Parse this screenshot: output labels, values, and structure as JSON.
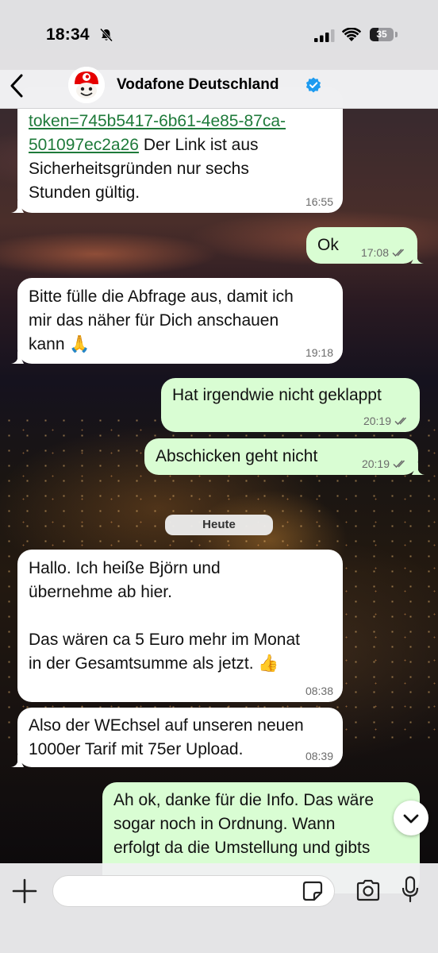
{
  "status_bar": {
    "time": "18:34",
    "battery": "35"
  },
  "header": {
    "contact_name": "Vodafone Deutschland"
  },
  "messages": [
    {
      "direction": "in",
      "link": "token=745b5417-6b61-4e85-87ca-\n501097ec2a26",
      "text": " Der Link ist aus\nSicherheitsgründen nur sechs\nStunden gültig.",
      "time": "16:55"
    },
    {
      "direction": "out",
      "text": "Ok",
      "time": "17:08"
    },
    {
      "direction": "in",
      "text": "Bitte fülle die Abfrage aus, damit ich\nmir das näher für Dich anschauen\nkann 🙏",
      "time": "19:18"
    },
    {
      "direction": "out",
      "text": "Hat irgendwie nicht geklappt",
      "time": "20:19"
    },
    {
      "direction": "out",
      "text": "Abschicken geht nicht",
      "time": "20:19"
    },
    {
      "direction": "in",
      "text": "Hallo. Ich heiße Björn und\nübernehme ab hier.\n\nDas wären ca 5 Euro mehr im Monat\nin der Gesamtsumme als jetzt. 👍",
      "time": "08:38"
    },
    {
      "direction": "in",
      "text": "Also der WEchsel auf unseren neuen\n1000er Tarif mit 75er Upload.",
      "time": "08:39"
    },
    {
      "direction": "out",
      "text": "Ah ok, danke für die Info. Das wäre\nsogar noch in Ordnung. Wann\nerfolgt da die Umstellung und gibts",
      "time": ""
    }
  ],
  "date_separator": "Heute",
  "composer": {
    "placeholder": ""
  },
  "colors": {
    "incoming": "#ffffff",
    "outgoing": "#d9fdd3",
    "link": "#1e7a3a",
    "verified": "#1d9bf0",
    "brand": "#e60000"
  }
}
